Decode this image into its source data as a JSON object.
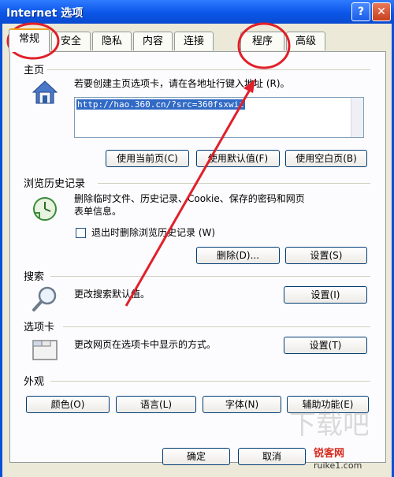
{
  "window": {
    "title": "Internet 选项",
    "help_label": "?",
    "close_label": "✕"
  },
  "tabs": [
    {
      "label": "常规",
      "active": true
    },
    {
      "label": "安全"
    },
    {
      "label": "隐私"
    },
    {
      "label": "内容"
    },
    {
      "label": "连接"
    },
    {
      "label": "程序"
    },
    {
      "label": "高级"
    }
  ],
  "homepage": {
    "section_title": "主页",
    "instruction": "若要创建主页选项卡，请在各地址行键入地址 (R)。",
    "url": "http://hao.360.cn/?src=360fsxwiz",
    "buttons": {
      "use_current": "使用当前页(C)",
      "use_default": "使用默认值(F)",
      "use_blank": "使用空白页(B)"
    },
    "icon": "house-icon"
  },
  "history": {
    "section_title": "浏览历史记录",
    "description_line1": "删除临时文件、历史记录、Cookie、保存的密码和网页",
    "description_line2": "表单信息。",
    "checkbox_label": "退出时删除浏览历史记录 (W)",
    "checkbox_checked": false,
    "buttons": {
      "delete": "删除(D)...",
      "settings": "设置(S)"
    },
    "icon": "history-clock-icon"
  },
  "search": {
    "section_title": "搜索",
    "description": "更改搜索默认值。",
    "buttons": {
      "settings": "设置(I)"
    },
    "icon": "magnifier-icon"
  },
  "tabs_section": {
    "section_title": "选项卡",
    "description": "更改网页在选项卡中显示的方式。",
    "buttons": {
      "settings": "设置(T)"
    },
    "icon": "tabs-window-icon"
  },
  "appearance": {
    "section_title": "外观",
    "buttons": {
      "colors": "颜色(O)",
      "languages": "语言(L)",
      "fonts": "字体(N)",
      "accessibility": "辅助功能(E)"
    }
  },
  "footer": {
    "ok": "确定",
    "cancel": "取消"
  },
  "watermark": {
    "brand_red": "锐客网",
    "brand_site": "ruike1.com"
  },
  "colors": {
    "annotation": "#e0202a",
    "title_bar": "#0b56e8",
    "dialog_bg": "#ece9d8"
  }
}
